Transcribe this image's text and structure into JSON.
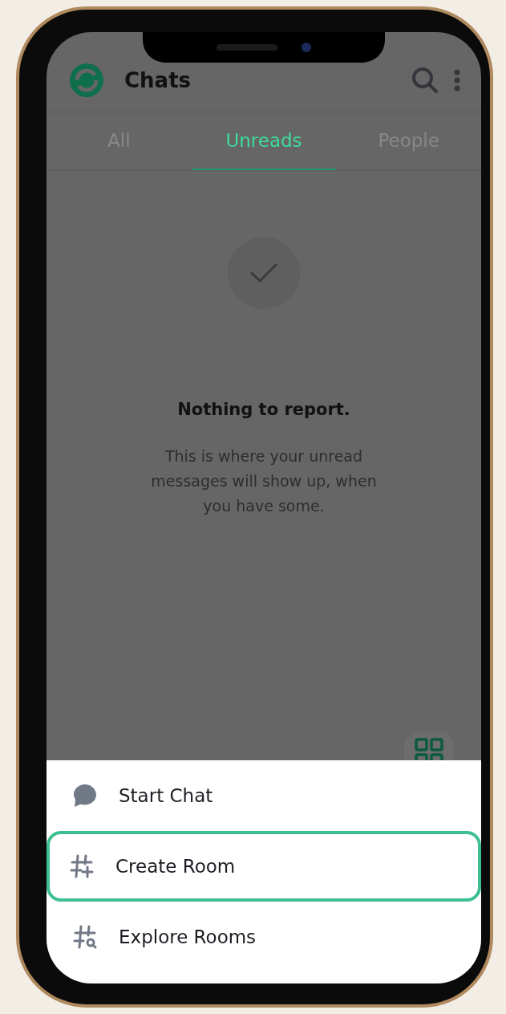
{
  "header": {
    "title": "Chats"
  },
  "tabs": [
    {
      "label": "All",
      "selected": false
    },
    {
      "label": "Unreads",
      "selected": true
    },
    {
      "label": "People",
      "selected": false
    }
  ],
  "empty_state": {
    "title": "Nothing to report.",
    "message": "This is where your unread messages will show up, when you have some."
  },
  "menu": [
    {
      "kind": "chat",
      "label": "Start Chat",
      "selected": false
    },
    {
      "kind": "create",
      "label": "Create Room",
      "selected": true
    },
    {
      "kind": "explore",
      "label": "Explore Rooms",
      "selected": false
    }
  ]
}
